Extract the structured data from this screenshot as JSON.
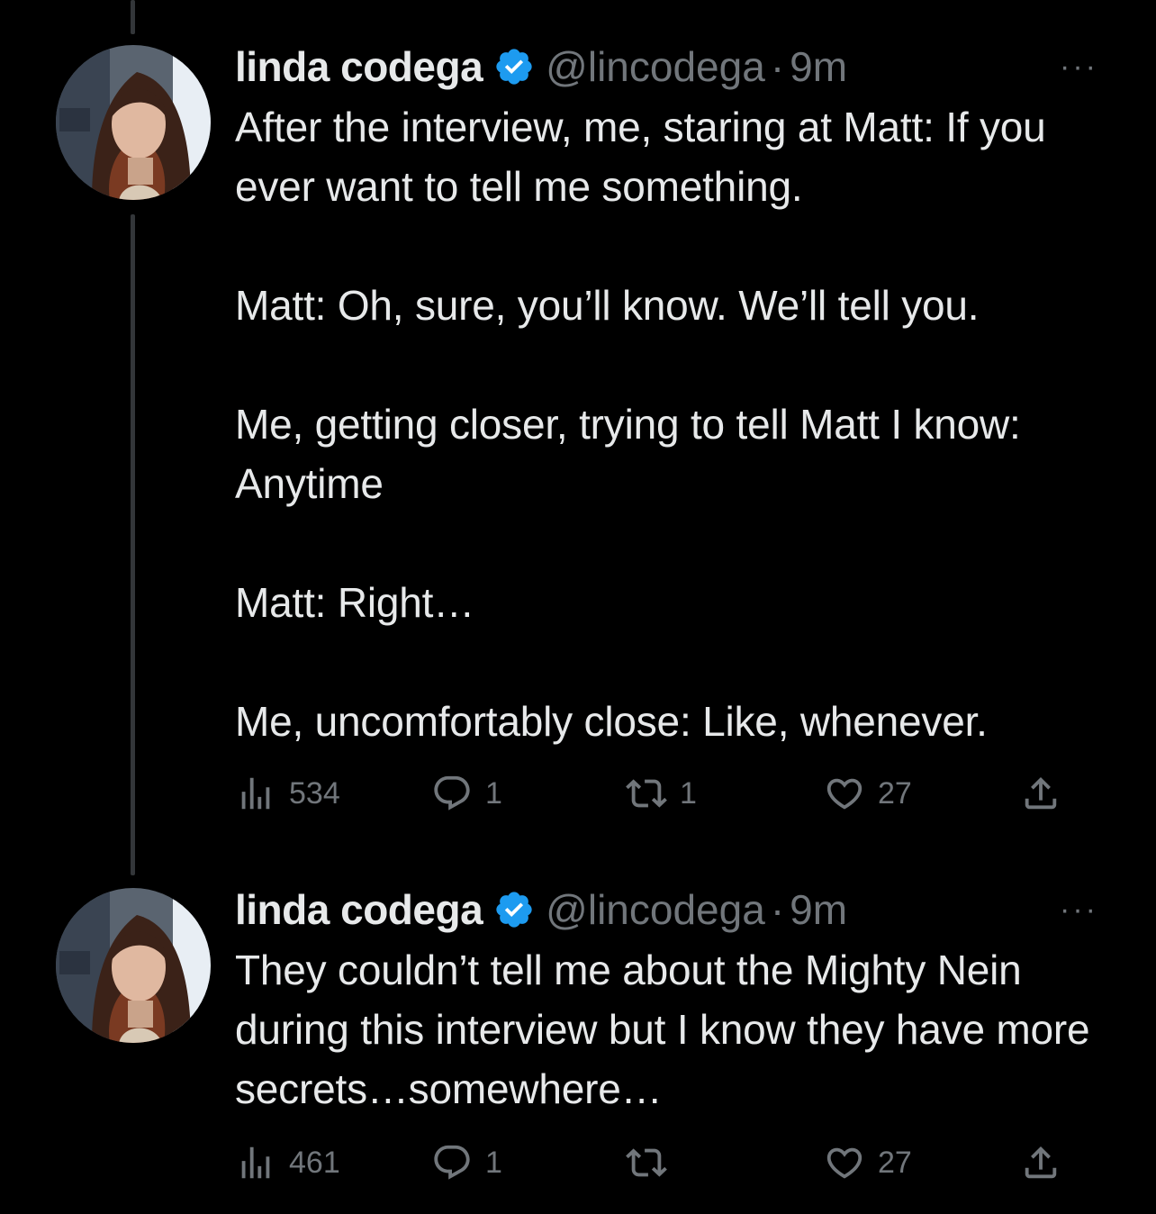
{
  "tweets": [
    {
      "author_name": "linda codega",
      "handle": "@lincodega",
      "separator": "·",
      "time": "9m",
      "more": "···",
      "paragraphs": [
        "After the interview, me, staring at Matt: If you ever want to tell me something.",
        "Matt: Oh, sure, you’ll know. We’ll tell you.",
        "Me, getting closer, trying to tell Matt I know: Anytime",
        "Matt: Right…",
        "Me, uncomfortably close: Like, whenever."
      ],
      "views": "534",
      "replies": "1",
      "retweets": "1",
      "likes": "27"
    },
    {
      "author_name": "linda codega",
      "handle": "@lincodega",
      "separator": "·",
      "time": "9m",
      "more": "···",
      "paragraphs": [
        "They couldn’t tell me about the Mighty Nein during this interview but I know they have more secrets…somewhere…"
      ],
      "views": "461",
      "replies": "1",
      "retweets": "",
      "likes": "27"
    }
  ],
  "colors": {
    "background": "#000000",
    "text": "#e7e9ea",
    "muted": "#71767b",
    "verified": "#1d9bf0",
    "thread_line": "#333639"
  }
}
